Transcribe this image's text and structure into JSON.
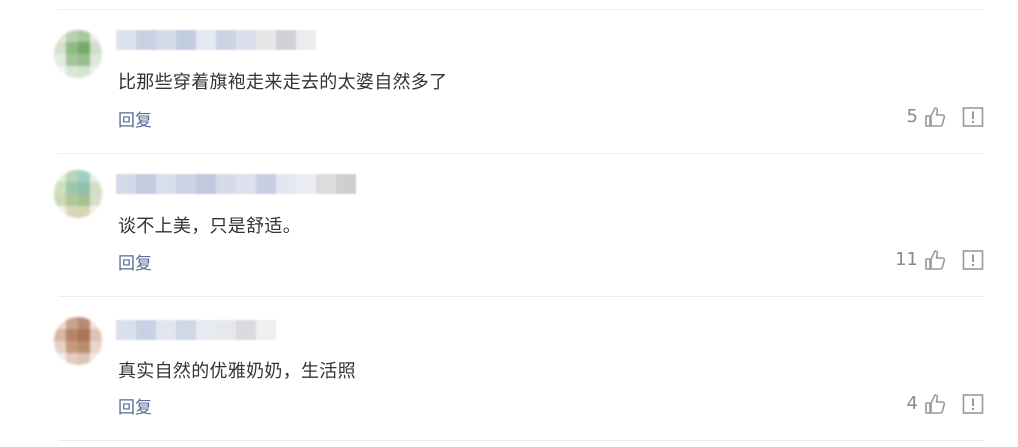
{
  "comments": [
    {
      "text": "比那些穿着旗袍走来走去的太婆自然多了",
      "reply_label": "回复",
      "likes": "5",
      "avatar_colors": [
        "#dfe8da",
        "#b9d1b1",
        "#a7c79d",
        "#e6ece3",
        "#d3e1cd",
        "#8fbb84",
        "#79a96f",
        "#cfe0c8",
        "#e4ebe1",
        "#a3c59a",
        "#98bd8e",
        "#dde8d9",
        "#f1f4ef",
        "#dbe6d6",
        "#d6e3d0",
        "#eef2ec"
      ],
      "name_colors": [
        "#dde3ee",
        "#c9d2e3",
        "#d4dbe8",
        "#c3cde0",
        "#e4e8f0",
        "#ccd4e4",
        "#d9dfeb",
        "#e7e7ea",
        "#d1d1d5",
        "#ececef"
      ]
    },
    {
      "text": "谈不上美，只是舒适。",
      "reply_label": "回复",
      "likes": "11",
      "avatar_colors": [
        "#e2ebd8",
        "#b7d4b8",
        "#9fcfc1",
        "#e6eee2",
        "#cfe0c0",
        "#9cc6ae",
        "#8ec1ad",
        "#d0e0c5",
        "#cdd8b6",
        "#b0c79b",
        "#a8bf95",
        "#d6e0c9",
        "#eff2ea",
        "#d9d7b8",
        "#d8d5b5",
        "#f0f2ea"
      ],
      "name_colors": [
        "#d2d9e8",
        "#c3cce0",
        "#d8dfec",
        "#cbd3e4",
        "#c0cade",
        "#d5dbe9",
        "#dde2ee",
        "#c7cfe2",
        "#e3e7f0",
        "#ebedf2",
        "#dcdcdf",
        "#cfcfd2"
      ]
    },
    {
      "text": "真实自然的优雅奶奶，生活照",
      "reply_label": "回复",
      "likes": "4",
      "avatar_colors": [
        "#ecd9ce",
        "#c9a48e",
        "#b88b72",
        "#efe2da",
        "#d9b6a2",
        "#b88467",
        "#a97457",
        "#e0c2b0",
        "#e6d3c8",
        "#c79a80",
        "#bb8b70",
        "#e8d6cb",
        "#f4ece7",
        "#e2cdbf",
        "#dcc5b6",
        "#f3ebe6"
      ],
      "name_colors": [
        "#d9e0ed",
        "#c9d2e4",
        "#e1e6ef",
        "#d0d8e8",
        "#e6eaf2",
        "#e8e8ec",
        "#dadadf",
        "#efeff2"
      ]
    }
  ],
  "colors": {
    "reply": "#576b95",
    "count": "#8a8a8a",
    "icon": "#9a9a9a",
    "divider": "#ececec"
  }
}
